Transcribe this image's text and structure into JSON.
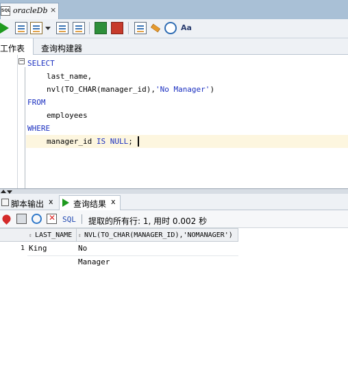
{
  "document_tab": {
    "title": "oracleDb",
    "icon": "sql-file-icon"
  },
  "toolbar": {
    "buttons": [
      "run-statement-icon",
      "run-script-icon",
      "commit-icon",
      "rollback-icon",
      "sql-tuning-icon",
      "clear-icon",
      "sql-history-icon",
      "format-icon"
    ]
  },
  "worksheet_tabs": {
    "worksheet": "工作表",
    "query_builder": "查询构建器"
  },
  "editor": {
    "line1": "SELECT",
    "line2": "last_name,",
    "line3_a": "nvl(TO_CHAR(manager_id),",
    "line3_b": "'No Manager'",
    "line3_c": ")",
    "line4": "FROM",
    "line5": "employees",
    "line6": "WHERE",
    "line7_a": "manager_id ",
    "line7_b": "IS NULL",
    "line7_c": ";"
  },
  "output_tabs": {
    "script_output": "脚本输出",
    "script_output_close": "x",
    "query_result": "查询结果",
    "query_result_close": "x"
  },
  "results_toolbar": {
    "sql_label": "SQL",
    "fetch_message": "提取的所有行: 1, 用时 0.002 秒"
  },
  "results": {
    "columns": [
      "LAST_NAME",
      "NVL(TO_CHAR(MANAGER_ID),'NOMANAGER')"
    ],
    "rows": [
      {
        "num": "1",
        "cells": [
          "King",
          "No Manager"
        ]
      }
    ]
  }
}
